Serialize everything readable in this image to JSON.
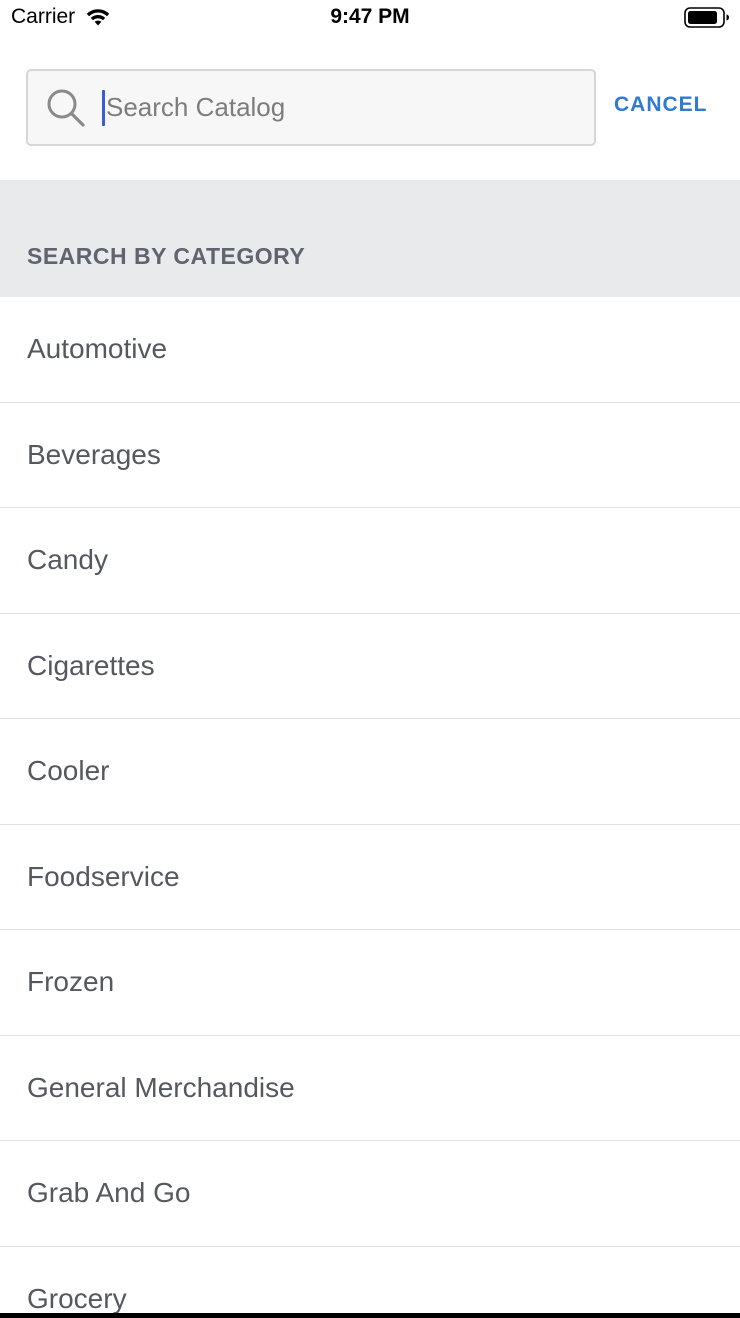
{
  "status_bar": {
    "carrier": "Carrier",
    "time": "9:47 PM"
  },
  "search": {
    "placeholder": "Search Catalog",
    "value": "",
    "cancel_label": "CANCEL"
  },
  "section": {
    "title": "SEARCH BY CATEGORY"
  },
  "categories": [
    {
      "label": "Automotive"
    },
    {
      "label": "Beverages"
    },
    {
      "label": "Candy"
    },
    {
      "label": "Cigarettes"
    },
    {
      "label": "Cooler"
    },
    {
      "label": "Foodservice"
    },
    {
      "label": "Frozen"
    },
    {
      "label": "General Merchandise"
    },
    {
      "label": "Grab And Go"
    },
    {
      "label": "Grocery"
    }
  ],
  "colors": {
    "accent": "#2f7bd0",
    "cursor": "#3d5bd9",
    "section_bg": "#e9eaec",
    "section_text": "#5f6470",
    "item_text": "#55595f"
  },
  "icons": {
    "wifi": "wifi-icon",
    "battery": "battery-icon",
    "search": "search-icon"
  }
}
